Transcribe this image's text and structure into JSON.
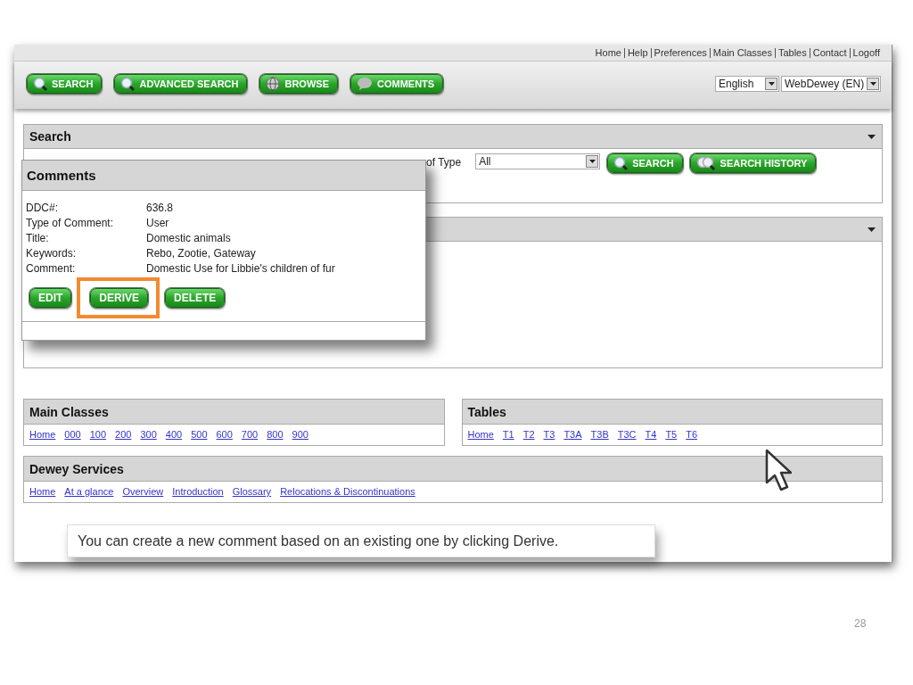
{
  "top_links": [
    "Home",
    "Help",
    "Preferences",
    "Main Classes",
    "Tables",
    "Contact",
    "Logoff"
  ],
  "toolbar_buttons": [
    {
      "label": "SEARCH",
      "kind": "search"
    },
    {
      "label": "ADVANCED SEARCH",
      "kind": "search"
    },
    {
      "label": "BROWSE",
      "kind": "browse"
    },
    {
      "label": "COMMENTS",
      "kind": "comment"
    }
  ],
  "language_select": {
    "value": "English"
  },
  "edition_select": {
    "value": "WebDewey (EN)"
  },
  "search_panel": {
    "title": "Search",
    "type_label": "of Type",
    "type_select": {
      "value": "All"
    },
    "buttons": [
      {
        "label": "SEARCH",
        "kind": "search"
      },
      {
        "label": "SEARCH HISTORY",
        "kind": "history"
      }
    ]
  },
  "comments_popup": {
    "title": "Comments",
    "fields": [
      {
        "label": "DDC#:",
        "value": "636.8"
      },
      {
        "label": "Type of Comment:",
        "value": "User"
      },
      {
        "label": "Title:",
        "value": "Domestic animals"
      },
      {
        "label": "Keywords:",
        "value": "Rebo, Zootie, Gateway"
      },
      {
        "label": "Comment:",
        "value": "Domestic Use for Libbie's children of fur"
      }
    ],
    "buttons": [
      {
        "label": "EDIT",
        "highlighted": false
      },
      {
        "label": "DERIVE",
        "highlighted": true
      },
      {
        "label": "DELETE",
        "highlighted": false
      }
    ]
  },
  "main_classes": {
    "title": "Main Classes",
    "links": [
      "Home",
      "000",
      "100",
      "200",
      "300",
      "400",
      "500",
      "600",
      "700",
      "800",
      "900"
    ]
  },
  "tables": {
    "title": "Tables",
    "links": [
      "Home",
      "T1",
      "T2",
      "T3",
      "T3A",
      "T3B",
      "T3C",
      "T4",
      "T5",
      "T6"
    ]
  },
  "dewey_services": {
    "title": "Dewey Services",
    "links": [
      "Home",
      "At a glance",
      "Overview",
      "Introduction",
      "Glossary",
      "Relocations & Discontinuations"
    ]
  },
  "callout": {
    "text": "You can create a new comment based on an existing one by clicking Derive."
  },
  "page_number": "28"
}
